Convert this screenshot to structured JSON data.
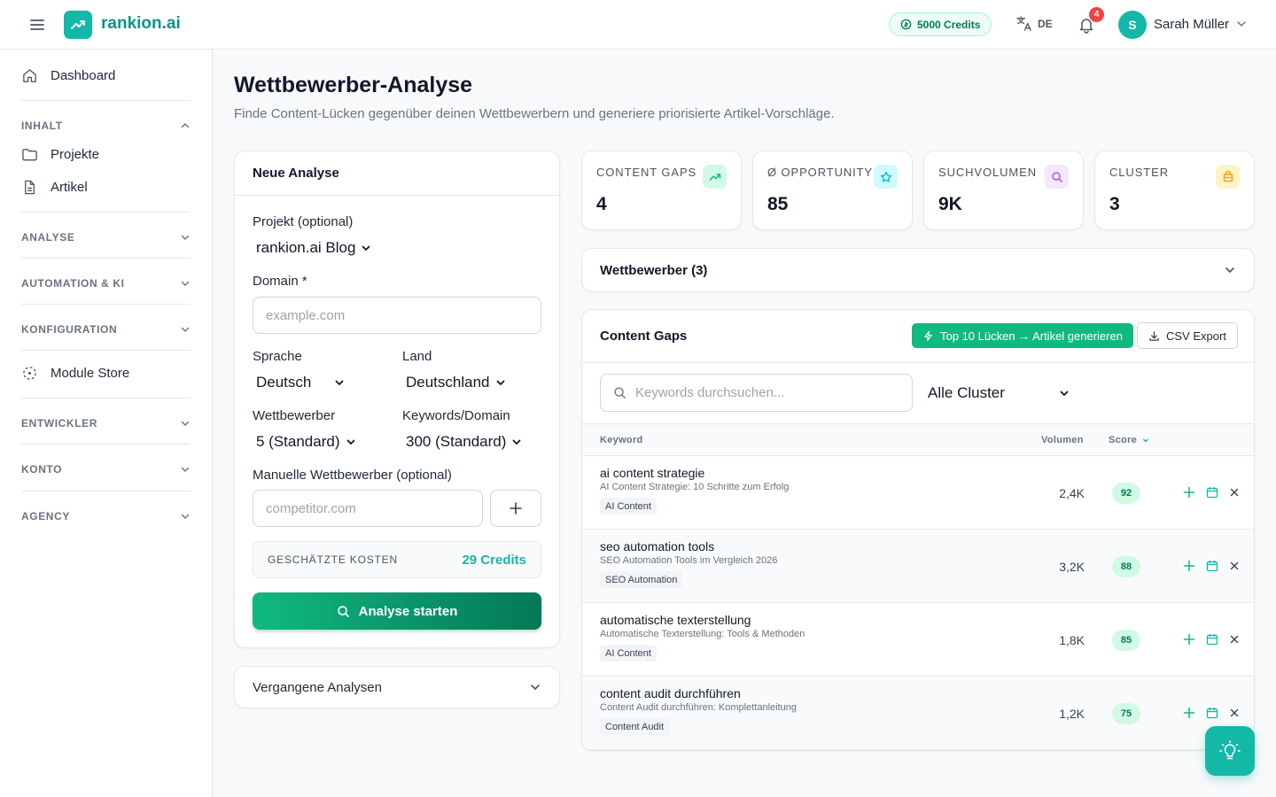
{
  "header": {
    "logo_text": "rankion.ai",
    "credits": "5000 Credits",
    "language": "DE",
    "notification_count": "4",
    "user_initial": "S",
    "user_name": "Sarah Müller"
  },
  "sidebar": {
    "dashboard": "Dashboard",
    "groups": {
      "inhalt": "INHALT",
      "analyse": "ANALYSE",
      "automation": "AUTOMATION & KI",
      "konfiguration": "KONFIGURATION",
      "entwickler": "ENTWICKLER",
      "konto": "KONTO",
      "agency": "AGENCY"
    },
    "projekte": "Projekte",
    "artikel": "Artikel",
    "module_store": "Module Store"
  },
  "page": {
    "title": "Wettbewerber-Analyse",
    "subtitle": "Finde Content-Lücken gegenüber deinen Wettbewerbern und generiere priorisierte Artikel-Vorschläge."
  },
  "form": {
    "title": "Neue Analyse",
    "project_label": "Projekt (optional)",
    "project_value": "rankion.ai Blog",
    "domain_label": "Domain *",
    "domain_placeholder": "example.com",
    "language_label": "Sprache",
    "language_value": "Deutsch",
    "country_label": "Land",
    "country_value": "Deutschland",
    "competitors_label": "Wettbewerber",
    "competitors_value": "5 (Standard)",
    "keywords_label": "Keywords/Domain",
    "keywords_value": "300 (Standard)",
    "manual_label": "Manuelle Wettbewerber (optional)",
    "manual_placeholder": "competitor.com",
    "cost_label": "GESCHÄTZTE KOSTEN",
    "cost_value": "29 Credits",
    "start_label": "Analyse starten"
  },
  "past": {
    "label": "Vergangene Analysen"
  },
  "stats": [
    {
      "label": "CONTENT GAPS",
      "value": "4",
      "color": "#10b981",
      "icon": "trend-up-icon"
    },
    {
      "label": "Ø OPPORTUNITY",
      "value": "85",
      "color": "#06b6d4",
      "icon": "star-icon"
    },
    {
      "label": "SUCHVOLUMEN",
      "value": "9K",
      "color": "#a855f7",
      "icon": "search-icon"
    },
    {
      "label": "CLUSTER",
      "value": "3",
      "color": "#f59e0b",
      "icon": "layers-icon"
    }
  ],
  "competitors": {
    "label": "Wettbewerber (3)"
  },
  "gaps": {
    "title": "Content Gaps",
    "generate_label": "Top 10 Lücken → Artikel generieren",
    "csv_label": "CSV Export",
    "search_placeholder": "Keywords durchsuchen...",
    "cluster_value": "Alle Cluster",
    "col_keyword": "Keyword",
    "col_volume": "Volumen",
    "col_score": "Score",
    "rows": [
      {
        "keyword": "ai content strategie",
        "title": "AI Content Strategie: 10 Schritte zum Erfolg",
        "tag": "AI Content",
        "volume": "2,4K",
        "score": "92"
      },
      {
        "keyword": "seo automation tools",
        "title": "SEO Automation Tools im Vergleich 2026",
        "tag": "SEO Automation",
        "volume": "3,2K",
        "score": "88"
      },
      {
        "keyword": "automatische texterstellung",
        "title": "Automatische Texterstellung: Tools & Methoden",
        "tag": "AI Content",
        "volume": "1,8K",
        "score": "85"
      },
      {
        "keyword": "content audit durchführen",
        "title": "Content Audit durchführen: Komplettanleitung",
        "tag": "Content Audit",
        "volume": "1,2K",
        "score": "75"
      }
    ]
  },
  "colors": {
    "brand": "#14b8a6",
    "accent": "#10b981"
  }
}
